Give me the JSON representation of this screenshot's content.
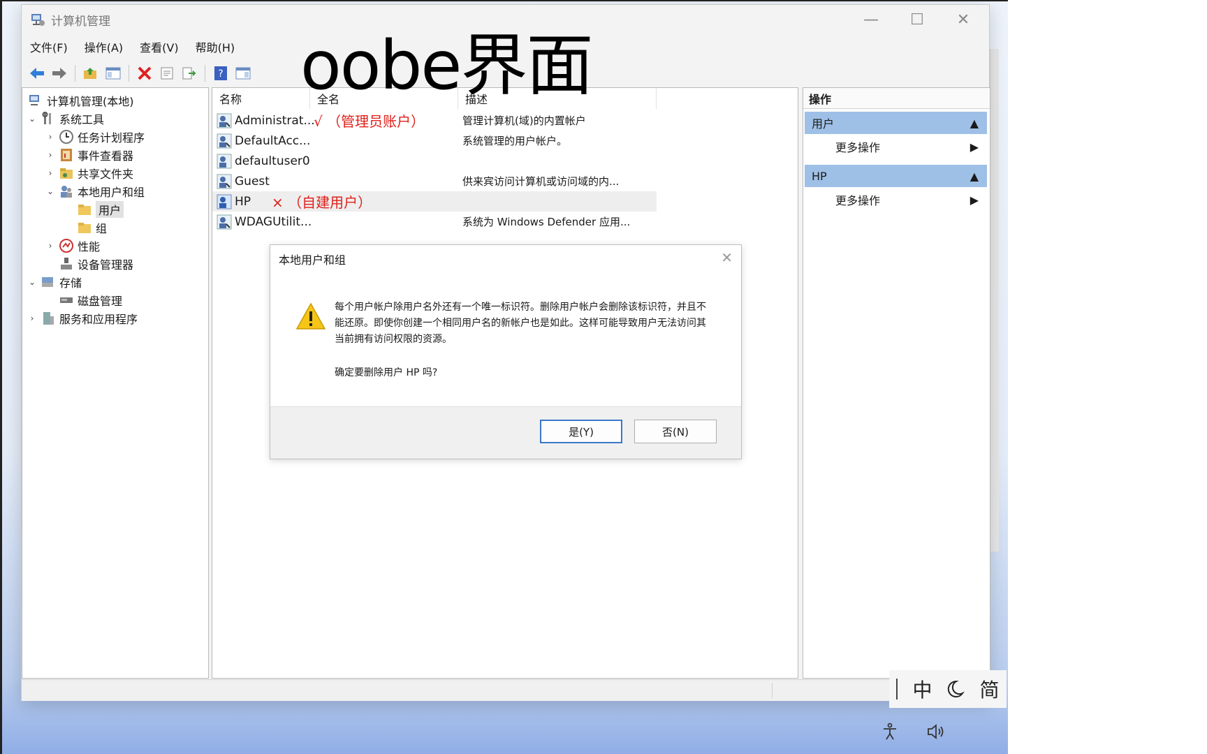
{
  "window": {
    "title": "计算机管理"
  },
  "menu": [
    "文件(F)",
    "操作(A)",
    "查看(V)",
    "帮助(H)"
  ],
  "overlay": {
    "text": "oobe界面"
  },
  "tree": {
    "root": "计算机管理(本地)",
    "system_tools": "系统工具",
    "task_scheduler": "任务计划程序",
    "event_viewer": "事件查看器",
    "shared_folders": "共享文件夹",
    "local_users": "本地用户和组",
    "users": "用户",
    "groups": "组",
    "performance": "性能",
    "device_manager": "设备管理器",
    "storage": "存储",
    "disk_management": "磁盘管理",
    "services_apps": "服务和应用程序"
  },
  "list": {
    "columns": [
      "名称",
      "全名",
      "描述"
    ],
    "rows": [
      {
        "name": "Administrat...",
        "full": "√ （管理员账户）",
        "desc": "管理计算机(域)的内置帐户"
      },
      {
        "name": "DefaultAcc...",
        "full": "",
        "desc": "系统管理的用户帐户。"
      },
      {
        "name": "defaultuser0",
        "full": "",
        "desc": ""
      },
      {
        "name": "Guest",
        "full": "",
        "desc": "供来宾访问计算机或访问域的内..."
      },
      {
        "name": "HP",
        "full": "× （自建用户）",
        "desc": ""
      },
      {
        "name": "WDAGUtilit...",
        "full": "",
        "desc": "系统为 Windows Defender 应用..."
      }
    ]
  },
  "actions": {
    "header": "操作",
    "section1": "用户",
    "section1_more": "更多操作",
    "section2": "HP",
    "section2_more": "更多操作"
  },
  "dialog": {
    "title": "本地用户和组",
    "message": "每个用户帐户除用户名外还有一个唯一标识符。删除用户帐户会删除该标识符，并且不能还原。即使你创建一个相同用户名的新帐户也是如此。这样可能导致用户无法访问其当前拥有访问权限的资源。",
    "question": "确定要删除用户 HP 吗?",
    "yes": "是(Y)",
    "no": "否(N)"
  },
  "ime": {
    "mode": "中",
    "width": "简"
  },
  "colors": {
    "accent": "#9fc0e6",
    "annotation": "#e0201a",
    "primary_btn_border": "#3b77c9"
  }
}
